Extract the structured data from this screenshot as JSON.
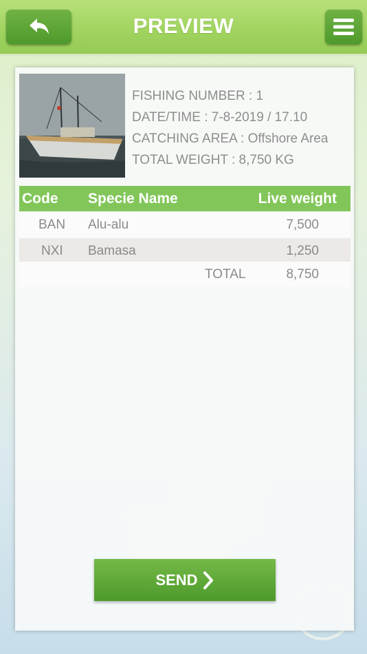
{
  "header": {
    "title": "PREVIEW",
    "back_icon": "back-arrow-icon",
    "menu_icon": "hamburger-menu-icon"
  },
  "info": {
    "fishing_number": "FISHING NUMBER : 1",
    "datetime": "DATE/TIME : 7-8-2019 / 17.10",
    "area": "CATCHING AREA : Offshore Area",
    "total_weight": "TOTAL WEIGHT : 8,750 KG"
  },
  "table": {
    "headers": {
      "code": "Code",
      "species": "Specie Name",
      "weight": "Live weight"
    },
    "rows": [
      {
        "code": "BAN",
        "species": "Alu-alu",
        "weight": "7,500"
      },
      {
        "code": "NXI",
        "species": "Bamasa",
        "weight": "1,250"
      }
    ],
    "total_label": "TOTAL",
    "total_value": "8,750"
  },
  "send_label": "SEND",
  "colors": {
    "header_green": "#9fd35e",
    "button_green": "#4f9a2c",
    "table_header": "#82c65a"
  }
}
